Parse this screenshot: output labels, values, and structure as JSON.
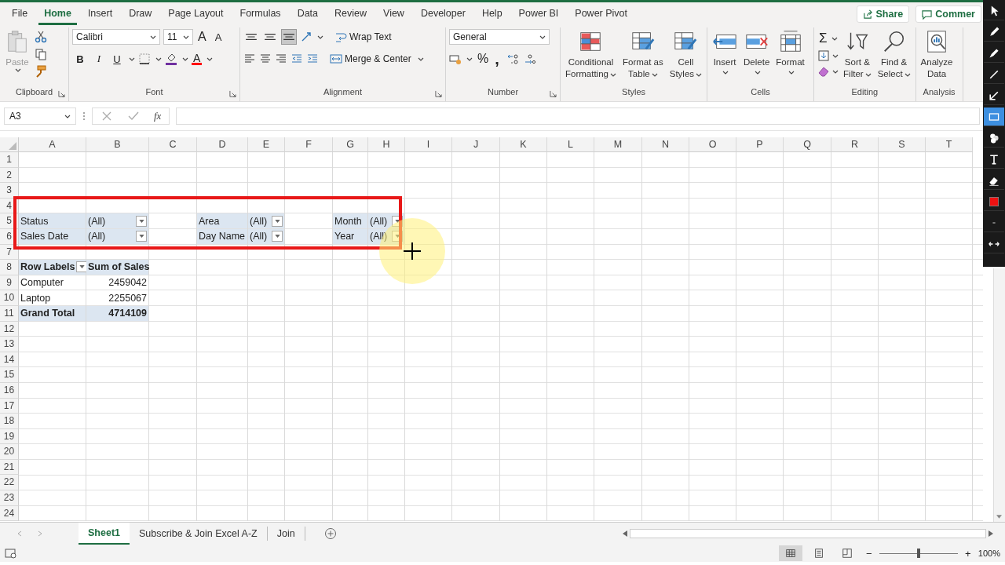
{
  "menu_tabs": [
    {
      "label": "File",
      "selected": false
    },
    {
      "label": "Home",
      "selected": true
    },
    {
      "label": "Insert",
      "selected": false
    },
    {
      "label": "Draw",
      "selected": false
    },
    {
      "label": "Page Layout",
      "selected": false
    },
    {
      "label": "Formulas",
      "selected": false
    },
    {
      "label": "Data",
      "selected": false
    },
    {
      "label": "Review",
      "selected": false
    },
    {
      "label": "View",
      "selected": false
    },
    {
      "label": "Developer",
      "selected": false
    },
    {
      "label": "Help",
      "selected": false
    },
    {
      "label": "Power BI",
      "selected": false
    },
    {
      "label": "Power Pivot",
      "selected": false
    }
  ],
  "share_button": {
    "label": "Share"
  },
  "comments_button": {
    "label": "Commer"
  },
  "ribbon": {
    "clipboard": {
      "title": "Clipboard",
      "paste": "Paste",
      "paste_disabled": true
    },
    "font": {
      "title": "Font",
      "name": "Calibri",
      "size": "11",
      "grow": "A",
      "shrink": "A",
      "bold": "B",
      "italic": "I",
      "underline": "U",
      "font_color": "A"
    },
    "alignment": {
      "title": "Alignment",
      "vertical": [
        {
          "selected": false
        },
        {
          "selected": false
        },
        {
          "selected": true
        }
      ],
      "wrap_text": "Wrap Text",
      "merge_center": "Merge & Center"
    },
    "number": {
      "title": "Number",
      "format": "General",
      "percent": "%",
      "comma": ","
    },
    "styles": {
      "title": "Styles",
      "buttons": [
        {
          "kind": "conditional",
          "lines": [
            "Conditional",
            "Formatting"
          ],
          "menu": true
        },
        {
          "kind": "format_table",
          "lines": [
            "Format as",
            "Table"
          ],
          "menu": true
        },
        {
          "kind": "cell_styles",
          "lines": [
            "Cell",
            "Styles"
          ],
          "menu": true
        }
      ]
    },
    "cells": {
      "title": "Cells",
      "buttons": [
        {
          "kind": "insert",
          "lines": [
            "Insert"
          ],
          "menu": true
        },
        {
          "kind": "delete",
          "lines": [
            "Delete"
          ],
          "menu": true
        },
        {
          "kind": "format",
          "lines": [
            "Format"
          ],
          "menu": true
        }
      ]
    },
    "editing": {
      "title": "Editing",
      "autosum": "Σ",
      "buttons": [
        {
          "kind": "sort",
          "lines": [
            "Sort &",
            "Filter"
          ],
          "menu": true
        },
        {
          "kind": "find",
          "lines": [
            "Find &",
            "Select"
          ],
          "menu": true
        }
      ]
    },
    "analysis": {
      "title": "Analysis",
      "buttons": [
        {
          "kind": "analyze",
          "lines": [
            "Analyze",
            "Data"
          ],
          "menu": false
        }
      ]
    }
  },
  "formula_bar": {
    "name_box": "A3",
    "fx": "fx"
  },
  "sheet": {
    "columns": [
      "A",
      "B",
      "C",
      "D",
      "E",
      "F",
      "G",
      "H",
      "I",
      "J",
      "K",
      "L",
      "M",
      "N",
      "O",
      "P",
      "Q",
      "R",
      "S",
      "T"
    ],
    "rows": [
      {
        "number": "1"
      },
      {
        "number": "2"
      },
      {
        "number": "3"
      },
      {
        "number": "4"
      },
      {
        "number": "5",
        "cells": [
          {
            "kind": "filter_field",
            "text": "Status"
          },
          {
            "kind": "filter_value",
            "text": "(All)",
            "dropdown": true
          },
          {},
          {
            "kind": "filter_field",
            "text": "Area"
          },
          {
            "kind": "filter_value",
            "text": "(All)",
            "dropdown": true
          },
          {},
          {
            "kind": "filter_field",
            "text": "Month"
          },
          {
            "kind": "filter_value",
            "text": "(All)",
            "dropdown": true
          }
        ]
      },
      {
        "number": "6",
        "cells": [
          {
            "kind": "filter_field",
            "text": "Sales Date"
          },
          {
            "kind": "filter_value",
            "text": "(All)",
            "dropdown": true
          },
          {},
          {
            "kind": "filter_field",
            "text": "Day Name"
          },
          {
            "kind": "filter_value",
            "text": "(All)",
            "dropdown": true
          },
          {},
          {
            "kind": "filter_field",
            "text": "Year"
          },
          {
            "kind": "filter_value",
            "text": "(All)",
            "dropdown": true
          }
        ]
      },
      {
        "number": "7"
      },
      {
        "number": "8",
        "cells": [
          {
            "kind": "header",
            "text": "Row Labels",
            "dropdown": true
          },
          {
            "kind": "header",
            "text": "Sum of Sales"
          }
        ]
      },
      {
        "number": "9",
        "cells": [
          {
            "kind": "item",
            "text": "Computer"
          },
          {
            "kind": "number",
            "text": "2459042"
          }
        ]
      },
      {
        "number": "10",
        "cells": [
          {
            "kind": "item",
            "text": "Laptop"
          },
          {
            "kind": "number",
            "text": "2255067"
          }
        ]
      },
      {
        "number": "11",
        "cells": [
          {
            "kind": "total_label",
            "text": "Grand Total"
          },
          {
            "kind": "total_number",
            "text": "4714109"
          }
        ]
      },
      {
        "number": "12"
      },
      {
        "number": "13"
      },
      {
        "number": "14"
      },
      {
        "number": "15"
      },
      {
        "number": "16"
      },
      {
        "number": "17"
      },
      {
        "number": "18"
      },
      {
        "number": "19"
      },
      {
        "number": "20"
      },
      {
        "number": "21"
      },
      {
        "number": "22"
      },
      {
        "number": "23"
      },
      {
        "number": "24"
      }
    ]
  },
  "annotation": {
    "kind": "rectangle"
  },
  "pointer": {
    "highlight": true
  },
  "sheet_tabs": [
    {
      "label": "Sheet1",
      "selected": true
    },
    {
      "label": "Subscribe & Join Excel A-Z",
      "selected": false
    },
    {
      "label": "Join",
      "selected": false
    }
  ],
  "status_bar": {
    "views": [
      {
        "kind": "normal",
        "selected": true
      },
      {
        "kind": "page_layout",
        "selected": false
      },
      {
        "kind": "page_break",
        "selected": false
      }
    ],
    "zoom_out": "−",
    "zoom_in": "+",
    "zoom_level": {
      "level": 0.5
    },
    "zoom": "100%"
  },
  "annotation_tools": [
    {
      "kind": "pointer",
      "selected": false
    },
    {
      "kind": "pencil",
      "selected": false
    },
    {
      "kind": "marker",
      "selected": false
    },
    {
      "kind": "line",
      "selected": false
    },
    {
      "kind": "arrow",
      "selected": false
    },
    {
      "kind": "rectangle",
      "selected": true
    },
    {
      "kind": "stamp",
      "selected": false
    },
    {
      "kind": "text",
      "selected": false
    },
    {
      "kind": "eraser",
      "selected": false
    },
    {
      "kind": "swatch",
      "selected": false
    },
    {
      "kind": "width",
      "selected": false
    },
    {
      "kind": "expand",
      "selected": false
    }
  ]
}
